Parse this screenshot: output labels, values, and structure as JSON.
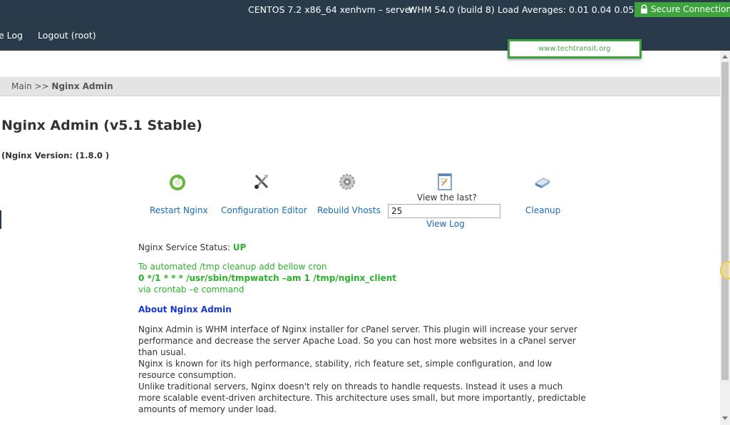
{
  "topbar": {
    "system": "CENTOS 7.2 x86_64 xenhvm – server",
    "whm": "WHM 54.0 (build 8)",
    "load": "Load Averages: 0.01 0.04 0.05",
    "secure_label": "Secure Connection",
    "nav": {
      "partial_link": "e Log",
      "logout": "Logout (root)"
    }
  },
  "watermark": "www.techtransit.org",
  "breadcrumb": {
    "home": "Main",
    "sep": ">>",
    "current": "Nginx Admin"
  },
  "page": {
    "title": "Nginx Admin (v5.1 Stable)",
    "version": "(Nginx Version: (1.8.0 )"
  },
  "tools": {
    "restart": "Restart Nginx",
    "config": "Configuration Editor",
    "rebuild": "Rebuild Vhosts",
    "view_last": "View the last?",
    "lines_value": "25",
    "view_log": "View Log",
    "cleanup": "Cleanup"
  },
  "status": {
    "label": "Nginx Service Status:",
    "value": "UP"
  },
  "cron": {
    "line1": "To automated /tmp cleanup add bellow cron",
    "line2": "0 */1 * * * /usr/sbin/tmpwatch –am 1 /tmp/nginx_client",
    "line3": "via crontab –e command"
  },
  "about": {
    "title": "About Nginx Admin",
    "p1": "Nginx Admin is WHM interface of Nginx installer for cPanel server. This plugin will increase your server performance and decrease the server Apache Load. So you can host more websites in a cPanel server than usual.",
    "p2": "Nginx is known for its high performance, stability, rich feature set, simple configuration, and low resource consumption.",
    "p3": "Unlike traditional servers, Nginx doesn't rely on threads to handle requests. Instead it uses a much more scalable event-driven architecture. This architecture uses small, but more importantly, predictable amounts of memory under load."
  },
  "colors": {
    "topbar": "#293a4a",
    "secure": "#3da33d",
    "link": "#1a6bb3",
    "status_up": "#2bb12b",
    "about": "#1538d3"
  }
}
